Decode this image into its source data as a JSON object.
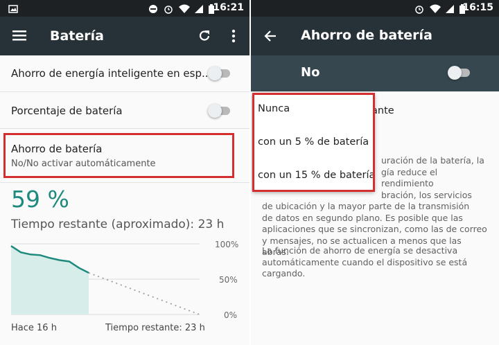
{
  "left": {
    "status_time": "16:21",
    "title": "Batería",
    "items": [
      {
        "label": "Ahorro de energía inteligente en esp..."
      },
      {
        "label": "Porcentaje de batería"
      },
      {
        "label": "Ahorro de batería",
        "sub": "No/No activar automáticamente"
      }
    ],
    "percent": "59 %",
    "remaining": "Tiempo restante (aproximado): 23 h",
    "chart_labels": {
      "top": "100%",
      "mid": "50%",
      "bottom": "0%"
    },
    "footer_left": "Hace 16 h",
    "footer_right": "Tiempo restante: 23 h"
  },
  "right": {
    "status_time": "16:15",
    "title": "Ahorro de batería",
    "master_label": "No",
    "hidden_row_tail": "ante",
    "description1": [
      "uración de la batería, la",
      "gía reduce el rendimiento",
      "bración, los servicios",
      "de ubicación y la mayor parte de la transmisión",
      "de datos en segundo plano. Es posible que las",
      "aplicaciones que se sincronizan, como las de correo",
      "y mensajes, no se actualicen a menos que las abras."
    ],
    "description2": [
      "La función de ahorro de energía se desactiva",
      "automáticamente cuando el dispositivo se está",
      "cargando."
    ],
    "menu": [
      "Nunca",
      "con un 5 % de batería",
      "con un 15 % de batería"
    ]
  },
  "colors": {
    "accent": "#1e8a7d",
    "appbar": "#263238",
    "highlight": "#d32f2f"
  },
  "chart_data": {
    "type": "area",
    "x": [
      "-16 h",
      "-14 h",
      "-12 h",
      "-10 h",
      "-8 h",
      "-6 h",
      "-4 h",
      "-2 h",
      "0 h"
    ],
    "series": [
      {
        "values": [
          97,
          88,
          85,
          84,
          80,
          77,
          75,
          66,
          59
        ]
      }
    ],
    "projection": {
      "x": [
        "0 h",
        "23 h"
      ],
      "values": [
        59,
        0
      ]
    },
    "ylim": [
      0,
      100
    ],
    "yticks": [
      "100%",
      "50%",
      "0%"
    ],
    "grid": true
  }
}
